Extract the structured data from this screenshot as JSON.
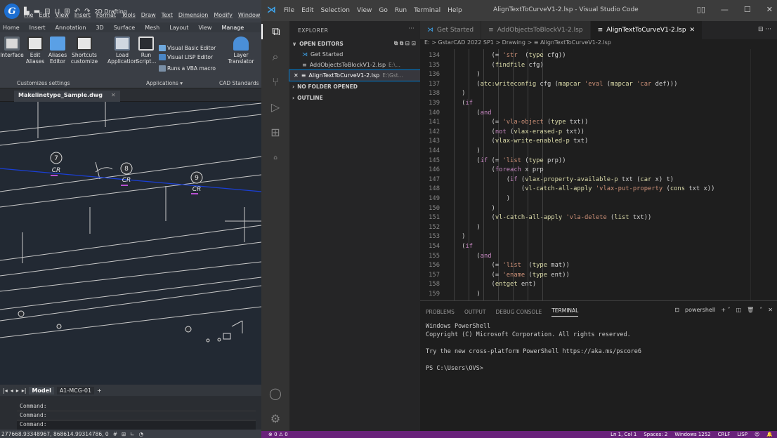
{
  "cad": {
    "logo": "G",
    "workspace": "2D Drafting",
    "menus": [
      "File",
      "Edit",
      "View",
      "Insert",
      "Format",
      "Tools",
      "Draw",
      "Text",
      "Dimension",
      "Modify",
      "Window"
    ],
    "ribbon_tabs": [
      "Home",
      "Insert",
      "Annotation",
      "3D",
      "Surface",
      "Mesh",
      "Layout",
      "View",
      "Manage"
    ],
    "ribbon_buttons": {
      "interface": "Interface",
      "edit_aliases": [
        "Edit",
        "Aliases"
      ],
      "aliases_editor": [
        "Aliases",
        "Editor"
      ],
      "shortcuts_customize": [
        "Shortcuts",
        "customize"
      ],
      "load_application": [
        "Load",
        "Application"
      ],
      "run_script": [
        "Run",
        "Script..."
      ],
      "vba_editor": "Visual Basic Editor",
      "lisp_editor": "Visual LISP Editor",
      "run_vba": "Runs a VBA macro",
      "layer_translator": [
        "Layer",
        "Translator"
      ]
    },
    "ribbon_groups": [
      "Customizes settings",
      "Applications",
      "CAD Standards"
    ],
    "document_tab": "Makelinetype_Sample.dwg",
    "markers": [
      {
        "num": "7",
        "code": "CR"
      },
      {
        "num": "8",
        "code": "CR"
      },
      {
        "num": "9",
        "code": "CR"
      }
    ],
    "layout_tabs": [
      "Model",
      "A1-MCG-01"
    ],
    "command_lines": [
      "Command:",
      "Command:",
      "Command:"
    ],
    "coords": "277668.93348967, 868614.99314786, 0"
  },
  "vscode": {
    "menus": [
      "File",
      "Edit",
      "Selection",
      "View",
      "Go",
      "Run",
      "Terminal",
      "Help"
    ],
    "window_title": "AlignTextToCurveV1-2.lsp - Visual Studio Code",
    "explorer_title": "EXPLORER",
    "open_editors_label": "OPEN EDITORS",
    "open_editors": [
      {
        "name": "Get Started",
        "path": ""
      },
      {
        "name": "AddObjectsToBlockV1-2.lsp",
        "path": "E:\\..."
      },
      {
        "name": "AlignTextToCurveV1-2.lsp",
        "path": "E:\\Gst..."
      }
    ],
    "no_folder": "NO FOLDER OPENED",
    "outline": "OUTLINE",
    "tabs": [
      "Get Started",
      "AddObjectsToBlockV1-2.lsp",
      "AlignTextToCurveV1-2.lsp"
    ],
    "breadcrumb": "E: > GstarCAD 2022 SP1 > Drawing > ≡ AlignTextToCurveV1-2.lsp",
    "code_lines": [
      {
        "n": "134",
        "t": "            (= 'str  (type cfg))"
      },
      {
        "n": "135",
        "t": "            (findfile cfg)"
      },
      {
        "n": "136",
        "t": "        )"
      },
      {
        "n": "137",
        "t": "        (atc:writeconfig cfg (mapcar 'eval (mapcar 'car def)))"
      },
      {
        "n": "138",
        "t": "    )"
      },
      {
        "n": "139",
        "t": "    (if"
      },
      {
        "n": "140",
        "t": "        (and"
      },
      {
        "n": "141",
        "t": "            (= 'vla-object (type txt))"
      },
      {
        "n": "142",
        "t": "            (not (vlax-erased-p txt))"
      },
      {
        "n": "143",
        "t": "            (vlax-write-enabled-p txt)"
      },
      {
        "n": "144",
        "t": "        )"
      },
      {
        "n": "145",
        "t": "        (if (= 'list (type prp))"
      },
      {
        "n": "146",
        "t": "            (foreach x prp"
      },
      {
        "n": "147",
        "t": "                (if (vlax-property-available-p txt (car x) t)"
      },
      {
        "n": "148",
        "t": "                    (vl-catch-all-apply 'vlax-put-property (cons txt x))"
      },
      {
        "n": "149",
        "t": "                )"
      },
      {
        "n": "150",
        "t": "            )"
      },
      {
        "n": "151",
        "t": "            (vl-catch-all-apply 'vla-delete (list txt))"
      },
      {
        "n": "152",
        "t": "        )"
      },
      {
        "n": "153",
        "t": "    )"
      },
      {
        "n": "154",
        "t": "    (if"
      },
      {
        "n": "155",
        "t": "        (and"
      },
      {
        "n": "156",
        "t": "            (= 'list  (type mat))"
      },
      {
        "n": "157",
        "t": "            (= 'ename (type ent))"
      },
      {
        "n": "158",
        "t": "            (entget ent)"
      },
      {
        "n": "159",
        "t": "        )"
      }
    ],
    "panel_tabs": [
      "PROBLEMS",
      "OUTPUT",
      "DEBUG CONSOLE",
      "TERMINAL"
    ],
    "shell": "powershell",
    "terminal": [
      "Windows PowerShell",
      "Copyright (C) Microsoft Corporation. All rights reserved.",
      "",
      "Try the new cross-platform PowerShell https://aka.ms/pscore6",
      "",
      "PS C:\\Users\\OVS>"
    ],
    "status_left": "⊗ 0  ⚠ 0",
    "status_right": [
      "Ln 1, Col 1",
      "Spaces: 2",
      "Windows 1252",
      "CRLF",
      "LISP"
    ]
  }
}
